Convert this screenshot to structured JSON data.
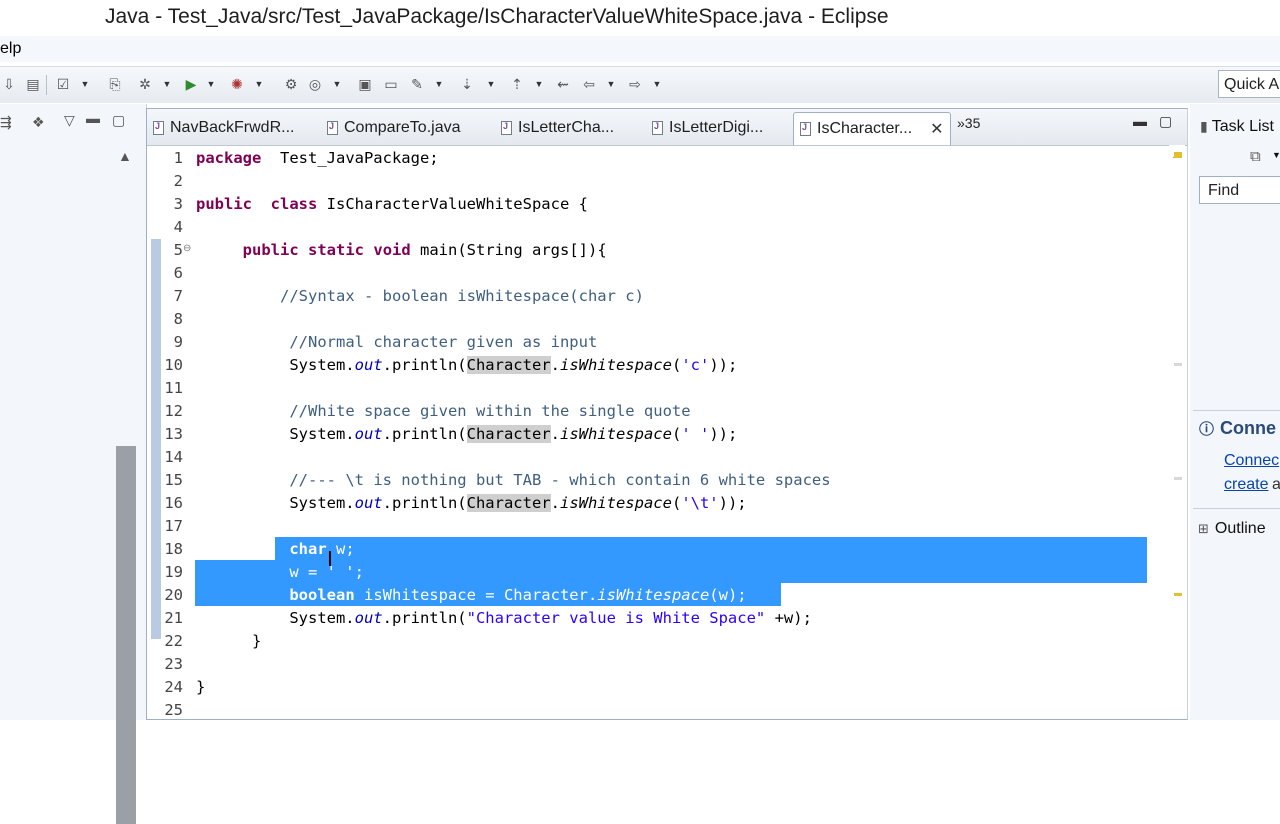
{
  "window": {
    "title": "Java - Test_Java/src/Test_JavaPackage/IsCharacterValueWhiteSpace.java - Eclipse"
  },
  "menubar": {
    "items": [
      "elp"
    ]
  },
  "quick_access": {
    "label": "Quick A"
  },
  "tabs": [
    {
      "label": "NavBackFrwdR..."
    },
    {
      "label": "CompareTo.java"
    },
    {
      "label": "IsLetterCha..."
    },
    {
      "label": "IsLetterDigi..."
    },
    {
      "label": "IsCharacter..."
    }
  ],
  "tab_overflow": "»35",
  "editor": {
    "lines": [
      {
        "n": "1",
        "parts": [
          [
            "kw",
            "package"
          ],
          [
            "",
            "  Test_JavaPackage;"
          ]
        ]
      },
      {
        "n": "2",
        "parts": []
      },
      {
        "n": "3",
        "parts": [
          [
            "kw",
            "public"
          ],
          [
            "",
            "  "
          ],
          [
            "kw",
            "class"
          ],
          [
            "",
            " IsCharacterValueWhiteSpace {"
          ]
        ]
      },
      {
        "n": "4",
        "parts": []
      },
      {
        "n": "5",
        "parts": [
          [
            "",
            "     "
          ],
          [
            "kw",
            "public"
          ],
          [
            "",
            " "
          ],
          [
            "kw",
            "static"
          ],
          [
            "",
            " "
          ],
          [
            "kw",
            "void"
          ],
          [
            "",
            " main(String args[]){"
          ]
        ]
      },
      {
        "n": "6",
        "parts": []
      },
      {
        "n": "7",
        "parts": [
          [
            "",
            "         "
          ],
          [
            "cm",
            "//Syntax - boolean isWhitespace(char c)"
          ]
        ]
      },
      {
        "n": "8",
        "parts": []
      },
      {
        "n": "9",
        "parts": [
          [
            "",
            "          "
          ],
          [
            "cm",
            "//Normal character given as input"
          ]
        ]
      },
      {
        "n": "10",
        "parts": [
          [
            "",
            "          System."
          ],
          [
            "fld",
            "out"
          ],
          [
            "",
            ".println("
          ],
          [
            "mark",
            "Character"
          ],
          [
            "",
            "."
          ],
          [
            "mth",
            "isWhitespace"
          ],
          [
            "",
            "("
          ],
          [
            "st",
            "'c'"
          ],
          [
            "",
            "));"
          ]
        ]
      },
      {
        "n": "11",
        "parts": []
      },
      {
        "n": "12",
        "parts": [
          [
            "",
            "          "
          ],
          [
            "cm",
            "//White space given within the single quote"
          ]
        ]
      },
      {
        "n": "13",
        "parts": [
          [
            "",
            "          System."
          ],
          [
            "fld",
            "out"
          ],
          [
            "",
            ".println("
          ],
          [
            "mark",
            "Character"
          ],
          [
            "",
            "."
          ],
          [
            "mth",
            "isWhitespace"
          ],
          [
            "",
            "("
          ],
          [
            "st",
            "' '"
          ],
          [
            "",
            "));"
          ]
        ]
      },
      {
        "n": "14",
        "parts": []
      },
      {
        "n": "15",
        "parts": [
          [
            "",
            "          "
          ],
          [
            "cm",
            "//--- \\t is nothing but TAB - which contain 6 white spaces"
          ]
        ]
      },
      {
        "n": "16",
        "parts": [
          [
            "",
            "          System."
          ],
          [
            "fld",
            "out"
          ],
          [
            "",
            ".println("
          ],
          [
            "mark",
            "Character"
          ],
          [
            "",
            "."
          ],
          [
            "mth",
            "isWhitespace"
          ],
          [
            "",
            "("
          ],
          [
            "st",
            "'\\t'"
          ],
          [
            "",
            "));"
          ]
        ]
      },
      {
        "n": "17",
        "parts": []
      },
      {
        "n": "18",
        "parts": [
          [
            "",
            "          "
          ],
          [
            "kw",
            "char"
          ],
          [
            "",
            " w;"
          ]
        ]
      },
      {
        "n": "19",
        "parts": [
          [
            "",
            "          w = ' ';"
          ]
        ]
      },
      {
        "n": "20",
        "parts": [
          [
            "",
            "          "
          ],
          [
            "kw",
            "boolean"
          ],
          [
            "",
            " isWhitespace = Character."
          ],
          [
            "mth",
            "isWhitespace"
          ],
          [
            "",
            "(w);"
          ]
        ]
      },
      {
        "n": "21",
        "parts": [
          [
            "",
            "          System."
          ],
          [
            "fld",
            "out"
          ],
          [
            "",
            ".println("
          ],
          [
            "st",
            "\"Character value is White Space\""
          ],
          [
            "",
            " +w);"
          ]
        ]
      },
      {
        "n": "22",
        "parts": [
          [
            "",
            "      }"
          ]
        ]
      },
      {
        "n": "23",
        "parts": []
      },
      {
        "n": "24",
        "parts": [
          [
            "",
            "}"
          ]
        ]
      },
      {
        "n": "25",
        "parts": []
      }
    ]
  },
  "right_pane": {
    "task_list": "Task List",
    "find": "Find",
    "connect_title": "Conne",
    "connect_link": "Connec",
    "create_link": "create",
    "create_suffix": "a",
    "outline": "Outline"
  },
  "colors": {
    "keyword": "#7f0055",
    "comment": "#3f5f7f",
    "string": "#2a00ff",
    "field": "#0000c0",
    "selection": "#3399ff"
  }
}
